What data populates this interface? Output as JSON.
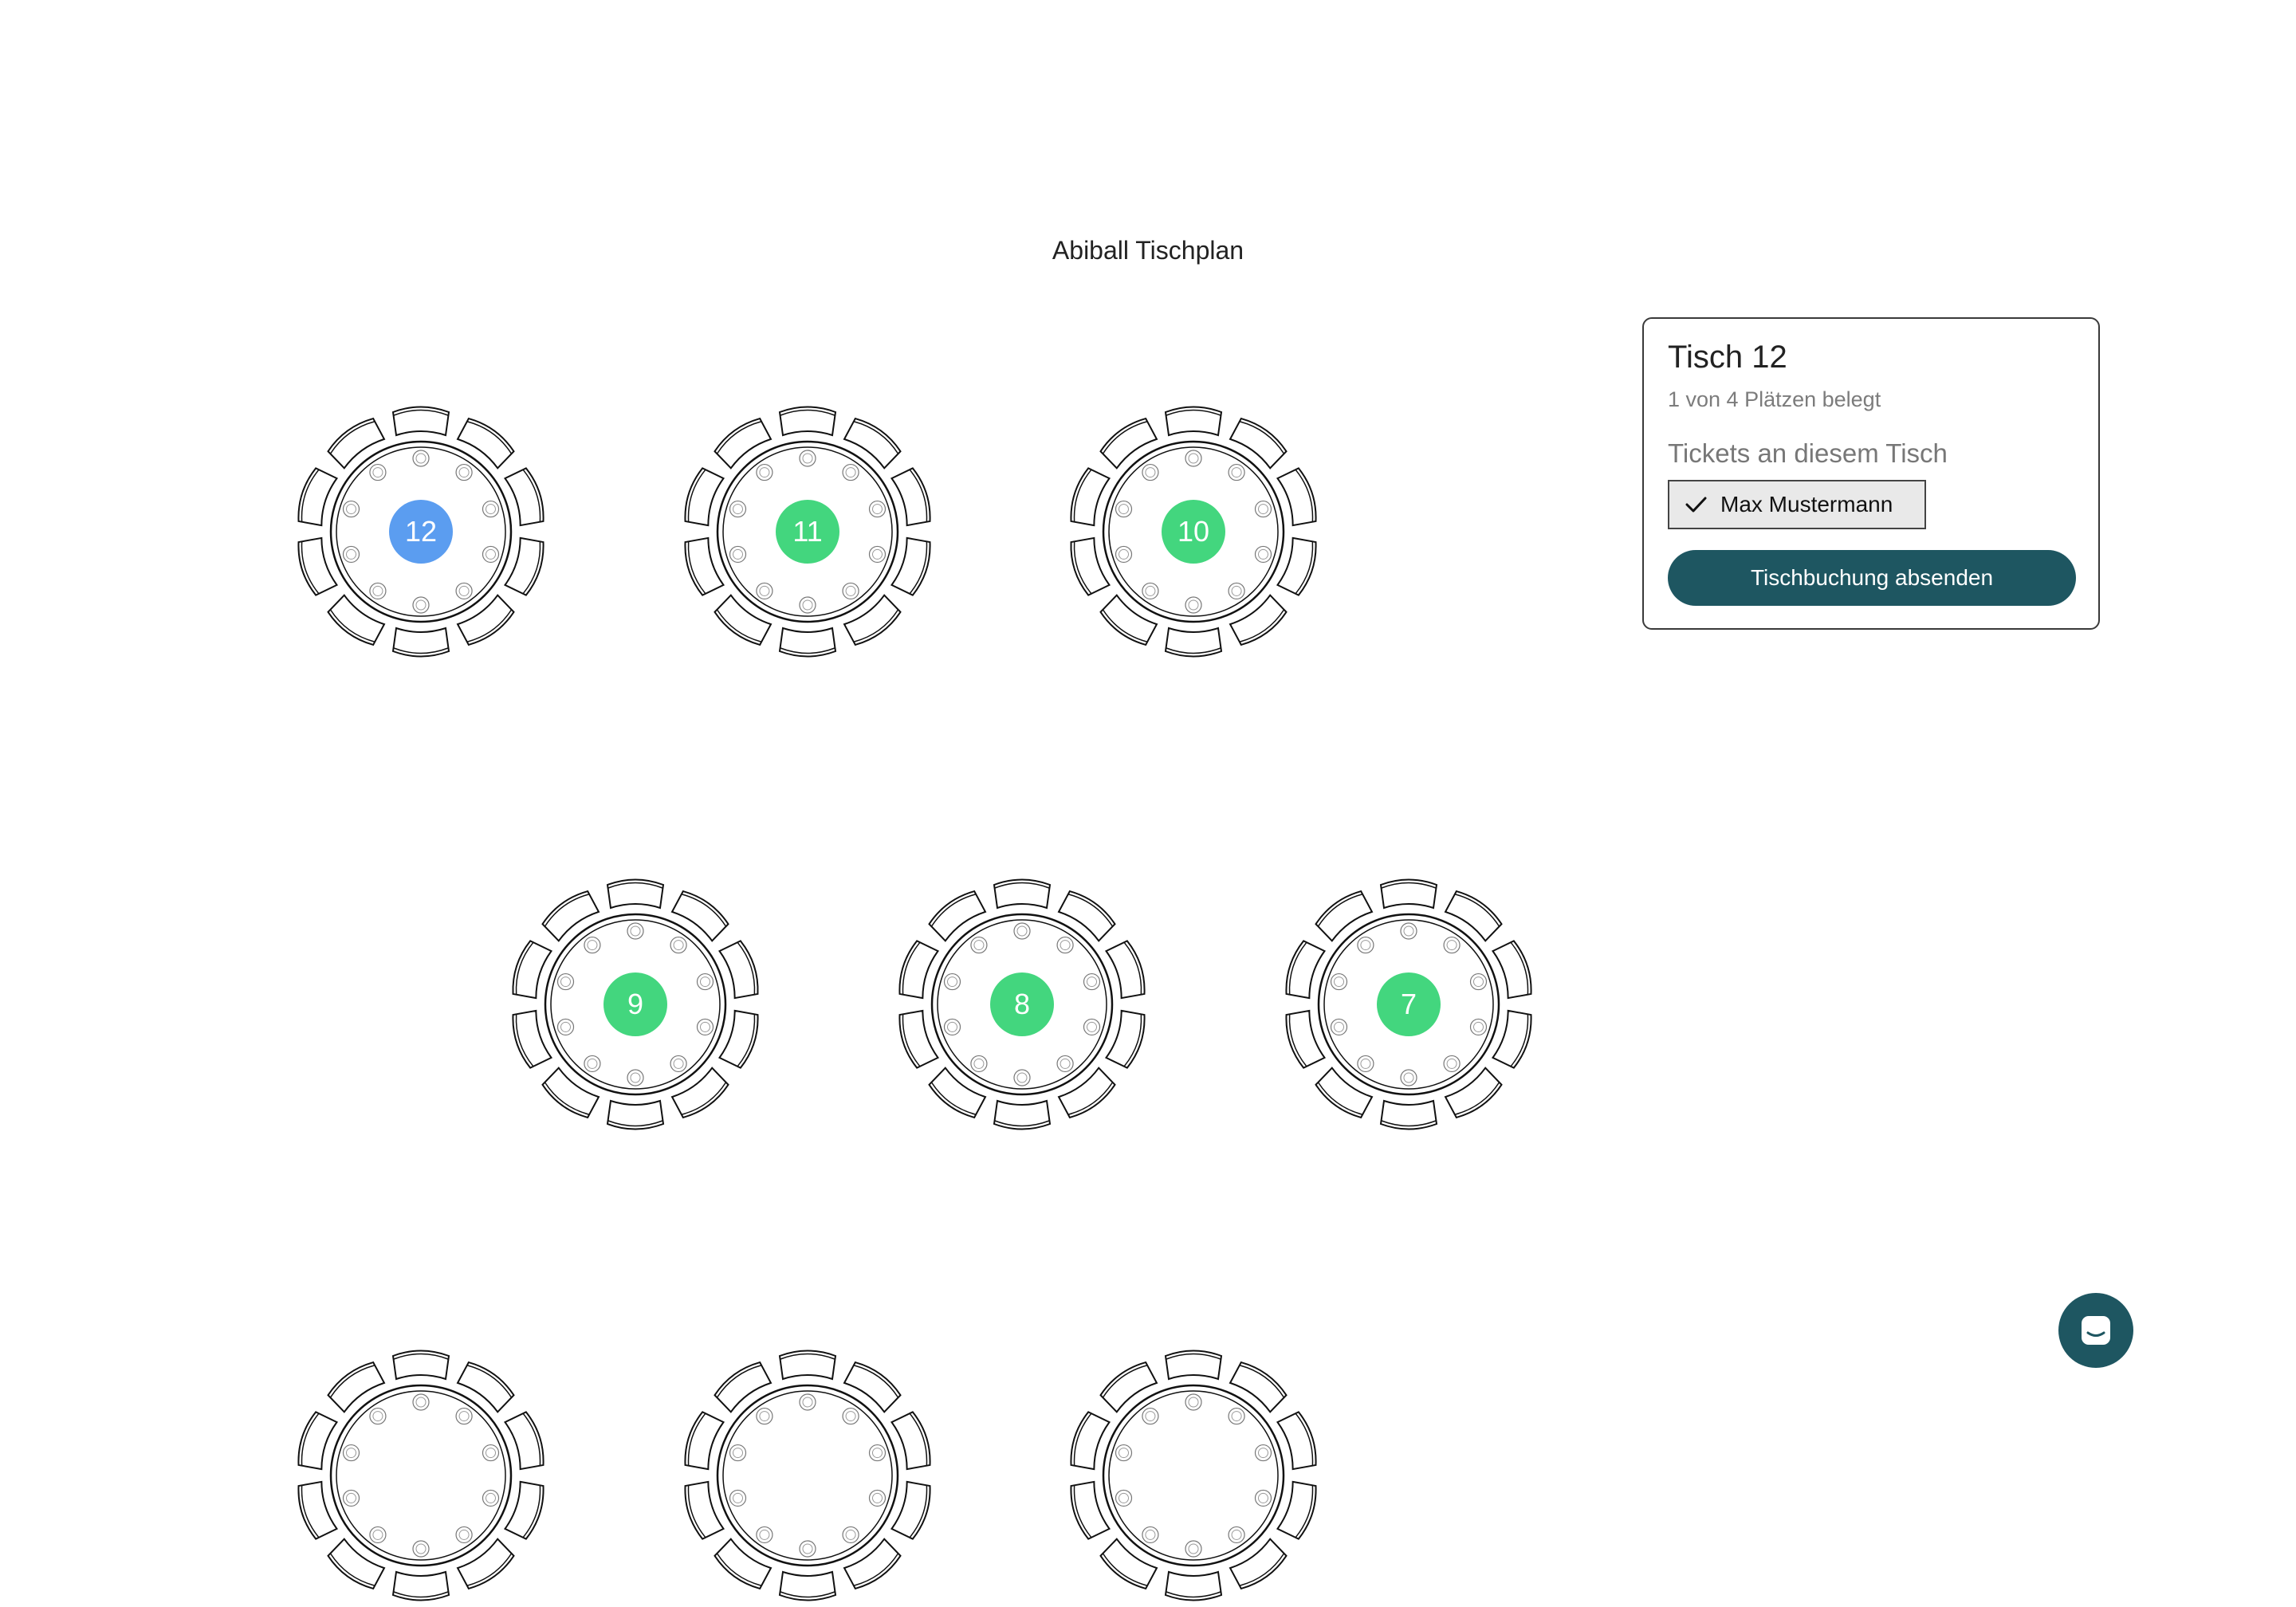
{
  "page": {
    "title": "Abiball Tischplan"
  },
  "colors": {
    "selected": "#5b9df0",
    "available": "#43d67e",
    "primary": "#1e5661"
  },
  "tables": [
    {
      "number": "12",
      "status": "selected"
    },
    {
      "number": "11",
      "status": "available"
    },
    {
      "number": "10",
      "status": "available"
    },
    {
      "number": "9",
      "status": "available"
    },
    {
      "number": "8",
      "status": "available"
    },
    {
      "number": "7",
      "status": "available"
    },
    {
      "number": "",
      "status": "available"
    },
    {
      "number": "",
      "status": "available"
    },
    {
      "number": "",
      "status": "available"
    }
  ],
  "panel": {
    "title": "Tisch 12",
    "subtitle": "1 von 4 Plätzen belegt",
    "tickets_label": "Tickets an diesem Tisch",
    "tickets": [
      {
        "name": "Max Mustermann",
        "checked": true
      }
    ],
    "submit_label": "Tischbuchung absenden"
  },
  "chat": {
    "icon": "chat-icon"
  }
}
